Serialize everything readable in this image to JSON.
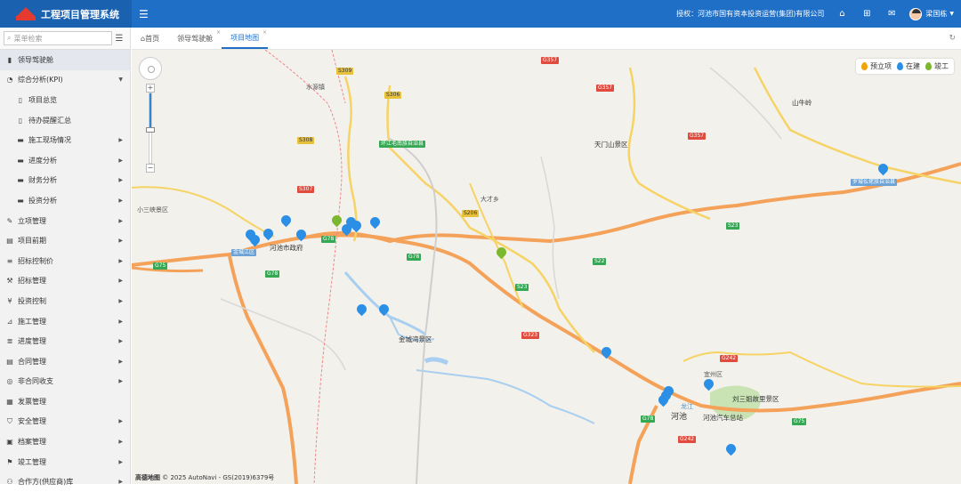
{
  "app": {
    "title": "工程项目管理系统"
  },
  "topbar": {
    "welcome": "授权：河池市国有资本投资运营(集团)有限公司",
    "user": "梁国栋"
  },
  "sidebar": {
    "search_placeholder": "菜单检索",
    "items": [
      {
        "label": "领导驾驶舱",
        "icon": "dashboard-icon",
        "active": true,
        "level": 0,
        "arrow": ""
      },
      {
        "label": "综合分析(KPI)",
        "icon": "pie-chart-icon",
        "level": 0,
        "arrow": "▼"
      },
      {
        "label": "项目总览",
        "icon": "file-icon",
        "level": 1,
        "arrow": ""
      },
      {
        "label": "待办提醒汇总",
        "icon": "file-icon",
        "level": 1,
        "arrow": ""
      },
      {
        "label": "施工现场情况",
        "icon": "folder-icon",
        "level": 1,
        "arrow": "▶"
      },
      {
        "label": "进度分析",
        "icon": "folder-icon",
        "level": 1,
        "arrow": "▶"
      },
      {
        "label": "财务分析",
        "icon": "folder-icon",
        "level": 1,
        "arrow": "▶"
      },
      {
        "label": "投资分析",
        "icon": "folder-icon",
        "level": 1,
        "arrow": "▶"
      },
      {
        "label": "立项管理",
        "icon": "edit-icon",
        "level": 0,
        "arrow": "▶"
      },
      {
        "label": "项目前期",
        "icon": "book-icon",
        "level": 0,
        "arrow": "▶"
      },
      {
        "label": "招标控制价",
        "icon": "list-icon",
        "level": 0,
        "arrow": "▶"
      },
      {
        "label": "招标管理",
        "icon": "gavel-icon",
        "level": 0,
        "arrow": "▶"
      },
      {
        "label": "投资控制",
        "icon": "money-icon",
        "level": 0,
        "arrow": "▶"
      },
      {
        "label": "施工管理",
        "icon": "crane-icon",
        "level": 0,
        "arrow": "▶"
      },
      {
        "label": "进度管理",
        "icon": "bars-icon",
        "level": 0,
        "arrow": "▶"
      },
      {
        "label": "合同管理",
        "icon": "contract-icon",
        "level": 0,
        "arrow": "▶"
      },
      {
        "label": "非合同收支",
        "icon": "coin-icon",
        "level": 0,
        "arrow": "▶"
      },
      {
        "label": "发票管理",
        "icon": "invoice-icon",
        "level": 0,
        "arrow": ""
      },
      {
        "label": "安全管理",
        "icon": "shield-icon",
        "level": 0,
        "arrow": "▶"
      },
      {
        "label": "档案管理",
        "icon": "archive-icon",
        "level": 0,
        "arrow": "▶"
      },
      {
        "label": "竣工管理",
        "icon": "flag-icon",
        "level": 0,
        "arrow": "▶"
      },
      {
        "label": "合作方(供应商)库",
        "icon": "handshake-icon",
        "level": 0,
        "arrow": "▶"
      }
    ]
  },
  "tabs": [
    {
      "label": "首页",
      "active": false,
      "closable": false,
      "icon": "home-icon"
    },
    {
      "label": "领导驾驶舱",
      "active": false,
      "closable": true
    },
    {
      "label": "项目地图",
      "active": true,
      "closable": true
    }
  ],
  "map": {
    "legend": [
      {
        "label": "预立项",
        "color": "#f0a30a"
      },
      {
        "label": "在建",
        "color": "#2b8fe6"
      },
      {
        "label": "竣工",
        "color": "#7cb82f"
      }
    ],
    "attribution_brand": "高德地图",
    "attribution_text": "© 2025 AutoNavi - GS(2019)6379号",
    "labels": [
      {
        "text": "环江毛南族自治县",
        "kind": "county"
      },
      {
        "text": "罗城仫佬族自治县",
        "kind": "county"
      },
      {
        "text": "金城江区",
        "kind": "county"
      },
      {
        "text": "河池",
        "kind": "city"
      },
      {
        "text": "天门山景区",
        "kind": "poi"
      },
      {
        "text": "金城湾景区",
        "kind": "poi"
      },
      {
        "text": "河池市政府",
        "kind": "poi"
      },
      {
        "text": "河池汽车总站",
        "kind": "poi"
      },
      {
        "text": "刘三姐故里景区",
        "kind": "poi"
      },
      {
        "text": "山牛岭",
        "kind": "poi"
      },
      {
        "text": "小三峡景区",
        "kind": "poi"
      },
      {
        "text": "水源镇",
        "kind": "town"
      },
      {
        "text": "大才乡",
        "kind": "town"
      },
      {
        "text": "龙江",
        "kind": "river"
      },
      {
        "text": "宜州区",
        "kind": "town"
      }
    ],
    "road_badges": [
      "S309",
      "S306",
      "G357",
      "G357",
      "G357",
      "S308",
      "S307",
      "G78",
      "G75",
      "G78",
      "G78",
      "S23",
      "S22",
      "S23",
      "G323",
      "G78",
      "G75",
      "G242",
      "G242",
      "S206"
    ]
  }
}
